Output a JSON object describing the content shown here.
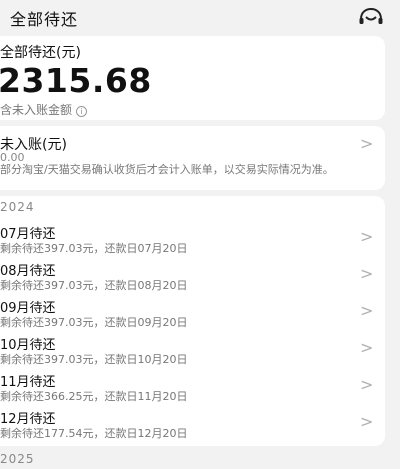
{
  "header": {
    "title": "全部待还",
    "support_icon": "headset-icon"
  },
  "total": {
    "label": "全部待还(元)",
    "amount": "2315.68",
    "note": "含未入账金额",
    "info_icon": "info-icon",
    "info_glyph": "i"
  },
  "pending": {
    "title": "未入账(元)",
    "amount": "0.00",
    "desc": "部分淘宝/天猫交易确认收货后才会计入账单，以交易实际情况为准。",
    "chevron": ">"
  },
  "list": {
    "year": "2024",
    "items": [
      {
        "title": "07月待还",
        "desc": "剩余待还397.03元，还款日07月20日",
        "chevron": ">"
      },
      {
        "title": "08月待还",
        "desc": "剩余待还397.03元，还款日08月20日",
        "chevron": ">"
      },
      {
        "title": "09月待还",
        "desc": "剩余待还397.03元，还款日09月20日",
        "chevron": ">"
      },
      {
        "title": "10月待还",
        "desc": "剩余待还397.03元，还款日10月20日",
        "chevron": ">"
      },
      {
        "title": "11月待还",
        "desc": "剩余待还366.25元，还款日11月20日",
        "chevron": ">"
      },
      {
        "title": "12月待还",
        "desc": "剩余待还177.54元，还款日12月20日",
        "chevron": ">"
      }
    ]
  },
  "next_year": "2025"
}
